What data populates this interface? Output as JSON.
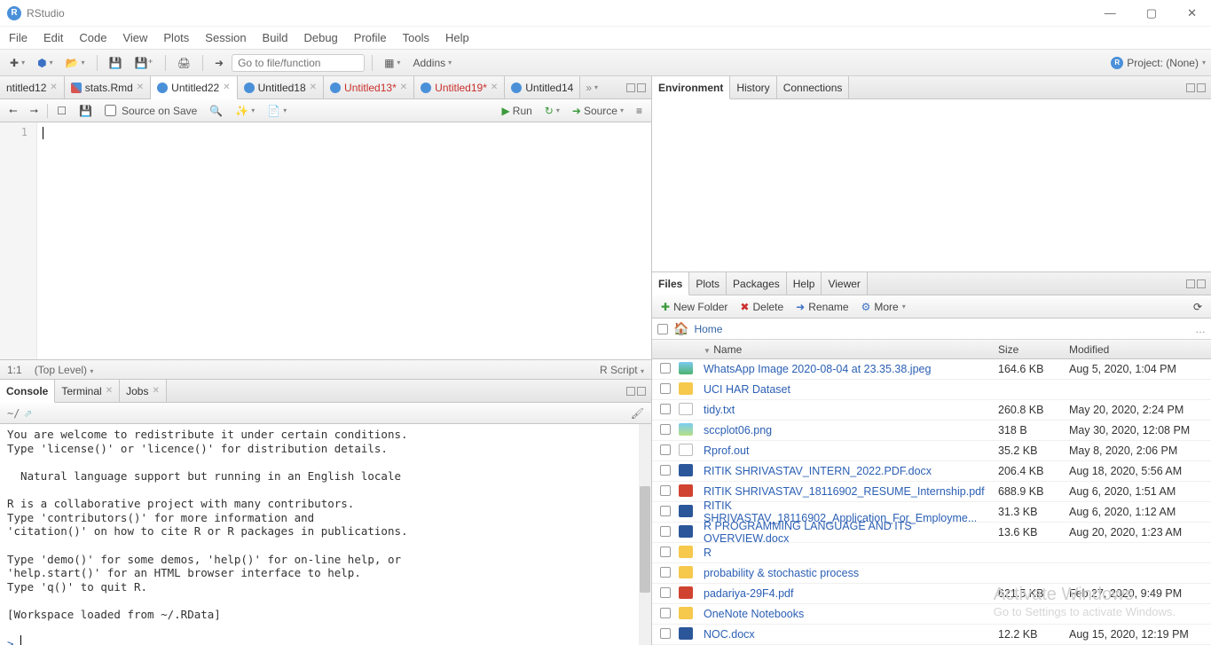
{
  "app": {
    "title": "RStudio"
  },
  "menu": [
    "File",
    "Edit",
    "Code",
    "View",
    "Plots",
    "Session",
    "Build",
    "Debug",
    "Profile",
    "Tools",
    "Help"
  ],
  "toolbar": {
    "goto_placeholder": "Go to file/function",
    "addins": "Addins",
    "project": "Project: (None)"
  },
  "source_tabs": [
    {
      "label": "ntitled12",
      "dirty": false,
      "kind": "blue"
    },
    {
      "label": "stats.Rmd",
      "dirty": false,
      "kind": "md"
    },
    {
      "label": "Untitled22",
      "dirty": false,
      "kind": "blue",
      "active": true
    },
    {
      "label": "Untitled18",
      "dirty": false,
      "kind": "blue"
    },
    {
      "label": "Untitled13*",
      "dirty": true,
      "kind": "blue"
    },
    {
      "label": "Untitled19*",
      "dirty": true,
      "kind": "blue"
    },
    {
      "label": "Untitled14",
      "dirty": false,
      "kind": "blue"
    }
  ],
  "editor_toolbar": {
    "source_on_save": "Source on Save",
    "run": "Run",
    "source": "Source"
  },
  "editor": {
    "line1": "1"
  },
  "statusbar": {
    "pos": "1:1",
    "scope": "(Top Level)",
    "lang": "R Script"
  },
  "console_tabs": [
    "Console",
    "Terminal",
    "Jobs"
  ],
  "console": {
    "cwd": "~/",
    "text": "You are welcome to redistribute it under certain conditions.\nType 'license()' or 'licence()' for distribution details.\n\n  Natural language support but running in an English locale\n\nR is a collaborative project with many contributors.\nType 'contributors()' for more information and\n'citation()' on how to cite R or R packages in publications.\n\nType 'demo()' for some demos, 'help()' for on-line help, or\n'help.start()' for an HTML browser interface to help.\nType 'q()' to quit R.\n\n[Workspace loaded from ~/.RData]\n",
    "prompt": ">"
  },
  "env_tabs": [
    "Environment",
    "History",
    "Connections"
  ],
  "files_tabs": [
    "Files",
    "Plots",
    "Packages",
    "Help",
    "Viewer"
  ],
  "files_toolbar": {
    "newfolder": "New Folder",
    "delete": "Delete",
    "rename": "Rename",
    "more": "More"
  },
  "files_crumb": "Home",
  "files_headers": {
    "name": "Name",
    "size": "Size",
    "mod": "Modified"
  },
  "files": [
    {
      "icon": "img",
      "name": "WhatsApp Image 2020-08-04 at 23.35.38.jpeg",
      "size": "164.6 KB",
      "mod": "Aug 5, 2020, 1:04 PM"
    },
    {
      "icon": "folder",
      "name": "UCI HAR Dataset",
      "size": "",
      "mod": ""
    },
    {
      "icon": "txt",
      "name": "tidy.txt",
      "size": "260.8 KB",
      "mod": "May 20, 2020, 2:24 PM"
    },
    {
      "icon": "png",
      "name": "sccplot06.png",
      "size": "318 B",
      "mod": "May 30, 2020, 12:08 PM"
    },
    {
      "icon": "rfile",
      "name": "Rprof.out",
      "size": "35.2 KB",
      "mod": "May 8, 2020, 2:06 PM"
    },
    {
      "icon": "doc",
      "name": "RITIK SHRIVASTAV_INTERN_2022.PDF.docx",
      "size": "206.4 KB",
      "mod": "Aug 18, 2020, 5:56 AM"
    },
    {
      "icon": "pdf",
      "name": "RITIK SHRIVASTAV_18116902_RESUME_Internship.pdf",
      "size": "688.9 KB",
      "mod": "Aug 6, 2020, 1:51 AM"
    },
    {
      "icon": "doc",
      "name": "RITIK SHRIVASTAV_18116902_Application_For_Employme...",
      "size": "31.3 KB",
      "mod": "Aug 6, 2020, 1:12 AM"
    },
    {
      "icon": "doc",
      "name": "R PROGRAMMING LANGUAGE AND ITS OVERVIEW.docx",
      "size": "13.6 KB",
      "mod": "Aug 20, 2020, 1:23 AM"
    },
    {
      "icon": "folder",
      "name": "R",
      "size": "",
      "mod": ""
    },
    {
      "icon": "folder",
      "name": "probability & stochastic process",
      "size": "",
      "mod": ""
    },
    {
      "icon": "pdf",
      "name": "padariya-29F4.pdf",
      "size": "621.5 KB",
      "mod": "Feb 27, 2020, 9:49 PM"
    },
    {
      "icon": "folder",
      "name": "OneNote Notebooks",
      "size": "",
      "mod": ""
    },
    {
      "icon": "doc",
      "name": "NOC.docx",
      "size": "12.2 KB",
      "mod": "Aug 15, 2020, 12:19 PM"
    }
  ],
  "watermark": {
    "line1": "Activate Windows",
    "line2": "Go to Settings to activate Windows."
  }
}
